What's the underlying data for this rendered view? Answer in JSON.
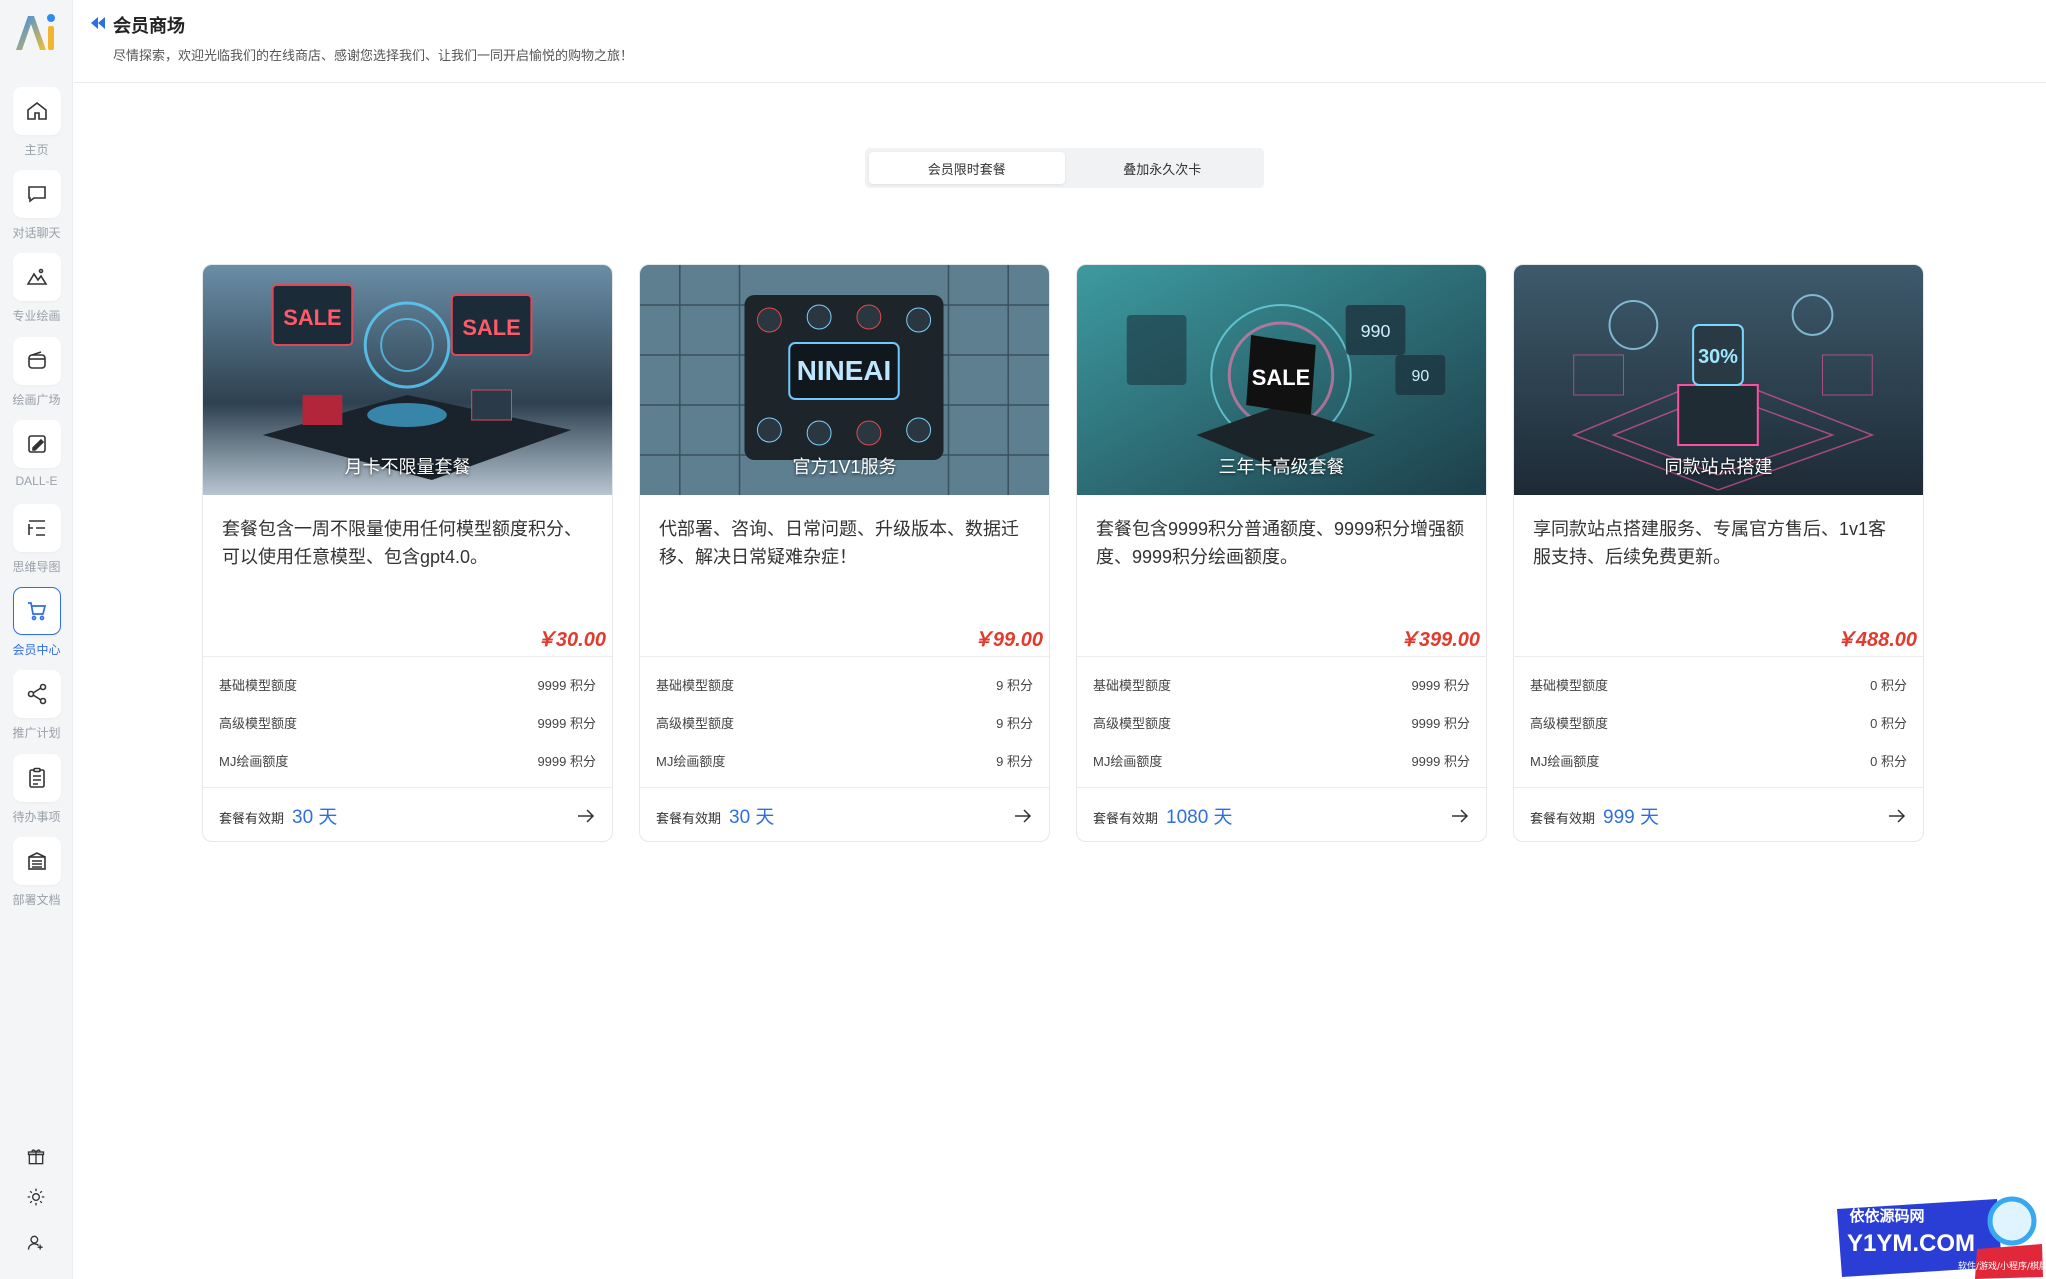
{
  "app": {
    "logo_text": "Ai"
  },
  "header": {
    "title": "会员商场",
    "subtitle": "尽情探索，欢迎光临我们的在线商店、感谢您选择我们、让我们一同开启愉悦的购物之旅！"
  },
  "sidebar": {
    "items": [
      {
        "label": "主页",
        "icon": "home-icon"
      },
      {
        "label": "对话聊天",
        "icon": "chat-icon"
      },
      {
        "label": "专业绘画",
        "icon": "image-icon"
      },
      {
        "label": "绘画广场",
        "icon": "wallet-icon"
      },
      {
        "label": "DALL-E",
        "icon": "edit-image-icon"
      },
      {
        "label": "思维导图",
        "icon": "mindmap-icon"
      },
      {
        "label": "会员中心",
        "icon": "cart-icon",
        "active": true
      },
      {
        "label": "推广计划",
        "icon": "share-icon"
      },
      {
        "label": "待办事项",
        "icon": "clipboard-icon"
      },
      {
        "label": "部署文档",
        "icon": "document-icon"
      }
    ],
    "bottom_icons": [
      "gift-icon",
      "sun-icon",
      "user-add-icon"
    ]
  },
  "tabs": [
    {
      "label": "会员限时套餐",
      "active": true
    },
    {
      "label": "叠加永久次卡",
      "active": false
    }
  ],
  "cards": [
    {
      "image_title": "月卡不限量套餐",
      "description": "套餐包含一周不限量使用任何模型额度积分、可以使用任意模型、包含gpt4.0。",
      "price": "￥30.00",
      "stats": [
        {
          "label": "基础模型额度",
          "value": "9999 积分"
        },
        {
          "label": "高级模型额度",
          "value": "9999 积分"
        },
        {
          "label": "MJ绘画额度",
          "value": "9999 积分"
        }
      ],
      "validity_label": "套餐有效期",
      "validity_days": "30 天"
    },
    {
      "image_title": "官方1V1服务",
      "description": "代部署、咨询、日常问题、升级版本、数据迁移、解决日常疑难杂症！",
      "price": "￥99.00",
      "stats": [
        {
          "label": "基础模型额度",
          "value": "9 积分"
        },
        {
          "label": "高级模型额度",
          "value": "9 积分"
        },
        {
          "label": "MJ绘画额度",
          "value": "9 积分"
        }
      ],
      "validity_label": "套餐有效期",
      "validity_days": "30 天"
    },
    {
      "image_title": "三年卡高级套餐",
      "description": "套餐包含9999积分普通额度、9999积分增强额度、9999积分绘画额度。",
      "price": "￥399.00",
      "stats": [
        {
          "label": "基础模型额度",
          "value": "9999 积分"
        },
        {
          "label": "高级模型额度",
          "value": "9999 积分"
        },
        {
          "label": "MJ绘画额度",
          "value": "9999 积分"
        }
      ],
      "validity_label": "套餐有效期",
      "validity_days": "1080 天"
    },
    {
      "image_title": "同款站点搭建",
      "description": "享同款站点搭建服务、专属官方售后、1v1客服支持、后续免费更新。",
      "price": "￥488.00",
      "stats": [
        {
          "label": "基础模型额度",
          "value": "0 积分"
        },
        {
          "label": "高级模型额度",
          "value": "0 积分"
        },
        {
          "label": "MJ绘画额度",
          "value": "0 积分"
        }
      ],
      "validity_label": "套餐有效期",
      "validity_days": "999 天"
    }
  ],
  "watermark": {
    "line1": "依依源码网",
    "line2": "Y1YM.COM",
    "line3": "软件/游戏/小程序/棋牌"
  },
  "colors": {
    "accent": "#2f6fe0",
    "price": "#e23b2e",
    "sidebar_bg": "#f4f5f7"
  }
}
